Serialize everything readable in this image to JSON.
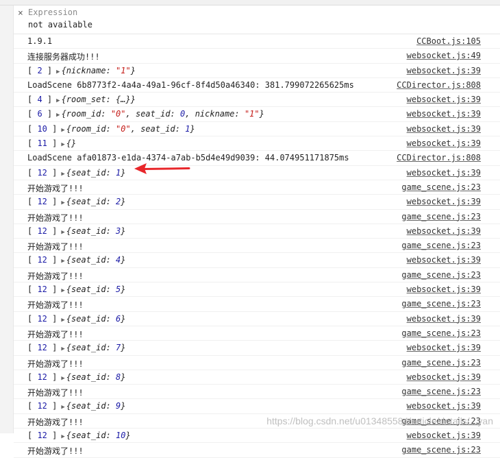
{
  "expression": {
    "close_symbol": "×",
    "label": "Expression",
    "value": "not available"
  },
  "log": [
    {
      "kind": "text",
      "text": "1.9.1",
      "source": "CCBoot.js:105"
    },
    {
      "kind": "text",
      "text": "连接服务器成功!!!",
      "source": "websocket.js:49"
    },
    {
      "kind": "obj",
      "index": "2",
      "parts": [
        [
          "k",
          "nickname"
        ],
        [
          "p",
          ": "
        ],
        [
          "s",
          "\"1\""
        ]
      ],
      "source": "websocket.js:39"
    },
    {
      "kind": "text",
      "text": "LoadScene 6b8773f2-4a4a-49a1-96cf-8f4d50a46340: 381.799072265625ms",
      "source": "CCDirector.js:808"
    },
    {
      "kind": "obj",
      "index": "4",
      "parts": [
        [
          "k",
          "room_set"
        ],
        [
          "p",
          ": {…}"
        ]
      ],
      "source": "websocket.js:39"
    },
    {
      "kind": "obj",
      "index": "6",
      "parts": [
        [
          "k",
          "room_id"
        ],
        [
          "p",
          ": "
        ],
        [
          "s",
          "\"0\""
        ],
        [
          "p",
          ", "
        ],
        [
          "k",
          "seat_id"
        ],
        [
          "p",
          ": "
        ],
        [
          "n",
          "0"
        ],
        [
          "p",
          ", "
        ],
        [
          "k",
          "nickname"
        ],
        [
          "p",
          ": "
        ],
        [
          "s",
          "\"1\""
        ]
      ],
      "source": "websocket.js:39"
    },
    {
      "kind": "obj",
      "index": "10",
      "parts": [
        [
          "k",
          "room_id"
        ],
        [
          "p",
          ": "
        ],
        [
          "s",
          "\"0\""
        ],
        [
          "p",
          ", "
        ],
        [
          "k",
          "seat_id"
        ],
        [
          "p",
          ": "
        ],
        [
          "n",
          "1"
        ]
      ],
      "source": "websocket.js:39"
    },
    {
      "kind": "obj",
      "index": "11",
      "parts": [],
      "source": "websocket.js:39"
    },
    {
      "kind": "text",
      "text": "LoadScene afa01873-e1da-4374-a7ab-b5d4e49d9039: 44.074951171875ms",
      "source": "CCDirector.js:808"
    },
    {
      "kind": "obj",
      "index": "12",
      "parts": [
        [
          "k",
          "seat_id"
        ],
        [
          "p",
          ": "
        ],
        [
          "n",
          "1"
        ]
      ],
      "source": "websocket.js:39"
    },
    {
      "kind": "text",
      "text": "开始游戏了!!!",
      "source": "game_scene.js:23"
    },
    {
      "kind": "obj",
      "index": "12",
      "parts": [
        [
          "k",
          "seat_id"
        ],
        [
          "p",
          ": "
        ],
        [
          "n",
          "2"
        ]
      ],
      "source": "websocket.js:39"
    },
    {
      "kind": "text",
      "text": "开始游戏了!!!",
      "source": "game_scene.js:23"
    },
    {
      "kind": "obj",
      "index": "12",
      "parts": [
        [
          "k",
          "seat_id"
        ],
        [
          "p",
          ": "
        ],
        [
          "n",
          "3"
        ]
      ],
      "source": "websocket.js:39"
    },
    {
      "kind": "text",
      "text": "开始游戏了!!!",
      "source": "game_scene.js:23"
    },
    {
      "kind": "obj",
      "index": "12",
      "parts": [
        [
          "k",
          "seat_id"
        ],
        [
          "p",
          ": "
        ],
        [
          "n",
          "4"
        ]
      ],
      "source": "websocket.js:39"
    },
    {
      "kind": "text",
      "text": "开始游戏了!!!",
      "source": "game_scene.js:23"
    },
    {
      "kind": "obj",
      "index": "12",
      "parts": [
        [
          "k",
          "seat_id"
        ],
        [
          "p",
          ": "
        ],
        [
          "n",
          "5"
        ]
      ],
      "source": "websocket.js:39"
    },
    {
      "kind": "text",
      "text": "开始游戏了!!!",
      "source": "game_scene.js:23"
    },
    {
      "kind": "obj",
      "index": "12",
      "parts": [
        [
          "k",
          "seat_id"
        ],
        [
          "p",
          ": "
        ],
        [
          "n",
          "6"
        ]
      ],
      "source": "websocket.js:39"
    },
    {
      "kind": "text",
      "text": "开始游戏了!!!",
      "source": "game_scene.js:23"
    },
    {
      "kind": "obj",
      "index": "12",
      "parts": [
        [
          "k",
          "seat_id"
        ],
        [
          "p",
          ": "
        ],
        [
          "n",
          "7"
        ]
      ],
      "source": "websocket.js:39"
    },
    {
      "kind": "text",
      "text": "开始游戏了!!!",
      "source": "game_scene.js:23"
    },
    {
      "kind": "obj",
      "index": "12",
      "parts": [
        [
          "k",
          "seat_id"
        ],
        [
          "p",
          ": "
        ],
        [
          "n",
          "8"
        ]
      ],
      "source": "websocket.js:39"
    },
    {
      "kind": "text",
      "text": "开始游戏了!!!",
      "source": "game_scene.js:23"
    },
    {
      "kind": "obj",
      "index": "12",
      "parts": [
        [
          "k",
          "seat_id"
        ],
        [
          "p",
          ": "
        ],
        [
          "n",
          "9"
        ]
      ],
      "source": "websocket.js:39"
    },
    {
      "kind": "text",
      "text": "开始游戏了!!!",
      "source": "game_scene.js:23"
    },
    {
      "kind": "obj",
      "index": "12",
      "parts": [
        [
          "k",
          "seat_id"
        ],
        [
          "p",
          ": "
        ],
        [
          "n",
          "10"
        ]
      ],
      "source": "websocket.js:39"
    },
    {
      "kind": "text",
      "text": "开始游戏了!!!",
      "source": "game_scene.js:23"
    }
  ],
  "annotation_arrow_color": "#e8262a",
  "watermark": "https://blog.csdn.net/u013485584/article/details/...yan"
}
